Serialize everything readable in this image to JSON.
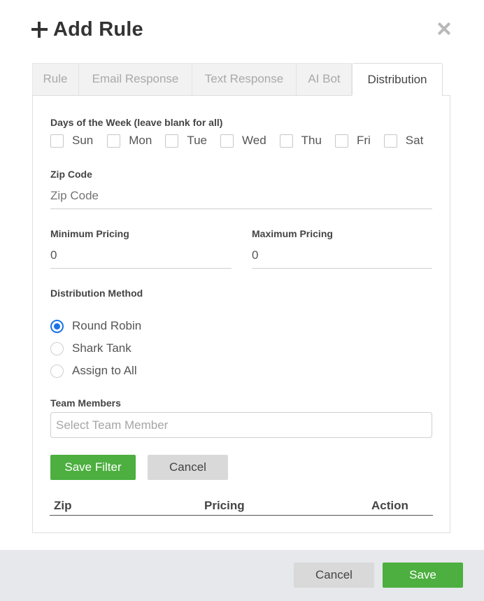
{
  "modal": {
    "title": "Add Rule",
    "plus_icon": "plus-icon",
    "close_icon": "close-icon"
  },
  "tabs": [
    {
      "label": "Rule",
      "active": false
    },
    {
      "label": "Email Response",
      "active": false
    },
    {
      "label": "Text Response",
      "active": false
    },
    {
      "label": "AI Bot",
      "active": false
    },
    {
      "label": "Distribution",
      "active": true
    }
  ],
  "form": {
    "days": {
      "label": "Days of the Week (leave blank for all)",
      "options": [
        {
          "label": "Sun",
          "checked": false
        },
        {
          "label": "Mon",
          "checked": false
        },
        {
          "label": "Tue",
          "checked": false
        },
        {
          "label": "Wed",
          "checked": false
        },
        {
          "label": "Thu",
          "checked": false
        },
        {
          "label": "Fri",
          "checked": false
        },
        {
          "label": "Sat",
          "checked": false
        }
      ]
    },
    "zip": {
      "label": "Zip Code",
      "placeholder": "Zip Code",
      "value": ""
    },
    "min_pricing": {
      "label": "Minimum Pricing",
      "value": "0"
    },
    "max_pricing": {
      "label": "Maximum Pricing",
      "value": "0"
    },
    "distribution_method": {
      "label": "Distribution Method",
      "options": [
        {
          "label": "Round Robin",
          "selected": true
        },
        {
          "label": "Shark Tank",
          "selected": false
        },
        {
          "label": "Assign to All",
          "selected": false
        }
      ]
    },
    "team_members": {
      "label": "Team Members",
      "placeholder": "Select Team Member"
    },
    "save_filter_label": "Save Filter",
    "cancel_label": "Cancel"
  },
  "table": {
    "columns": [
      "Zip",
      "Pricing",
      "Action"
    ],
    "rows": []
  },
  "footer": {
    "cancel_label": "Cancel",
    "save_label": "Save"
  },
  "colors": {
    "accent_green": "#4caf3f",
    "radio_blue": "#1a73e8",
    "footer_bg": "#e6e8ec"
  }
}
